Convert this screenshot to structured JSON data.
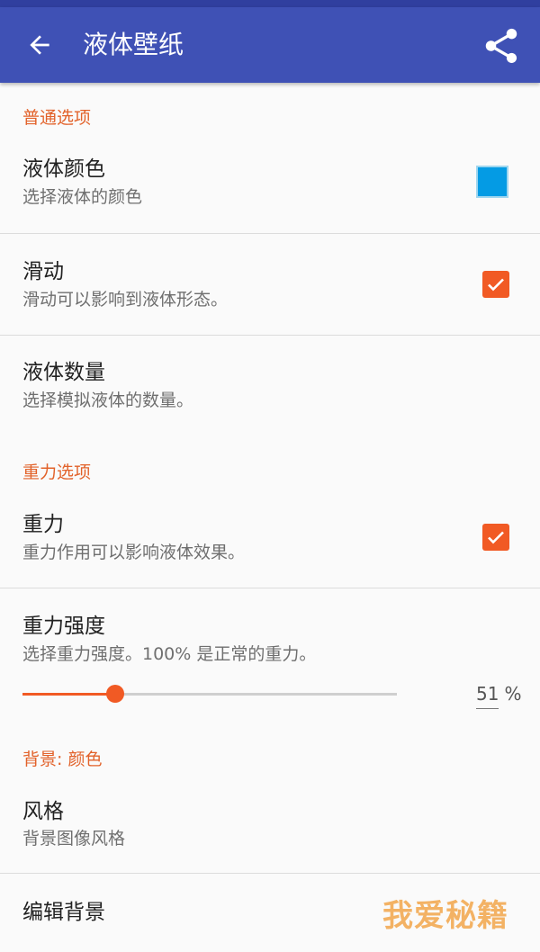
{
  "appbar": {
    "title": "液体壁纸",
    "back_icon": "arrow-back-icon",
    "share_icon": "share-icon",
    "color": "#3f51b5"
  },
  "sections": {
    "general": "普通选项",
    "gravity": "重力选项",
    "background": "背景: 颜色"
  },
  "prefs": {
    "fluid_color": {
      "title": "液体颜色",
      "summary": "选择液体的颜色",
      "swatch_color": "#049be4"
    },
    "swipe": {
      "title": "滑动",
      "summary": "滑动可以影响到液体形态。",
      "checked": true
    },
    "fluid_amount": {
      "title": "液体数量",
      "summary": "选择模拟液体的数量。"
    },
    "gravity": {
      "title": "重力",
      "summary": "重力作用可以影响液体效果。",
      "checked": true
    },
    "gravity_strength": {
      "title": "重力强度",
      "summary": "选择重力强度。100% 是正常的重力。",
      "value": 51,
      "unit": "%"
    },
    "style": {
      "title": "风格",
      "summary": "背景图像风格"
    },
    "edit_background": {
      "title": "编辑背景"
    }
  },
  "watermark": "我爱秘籍",
  "accent_color": "#f15a24"
}
